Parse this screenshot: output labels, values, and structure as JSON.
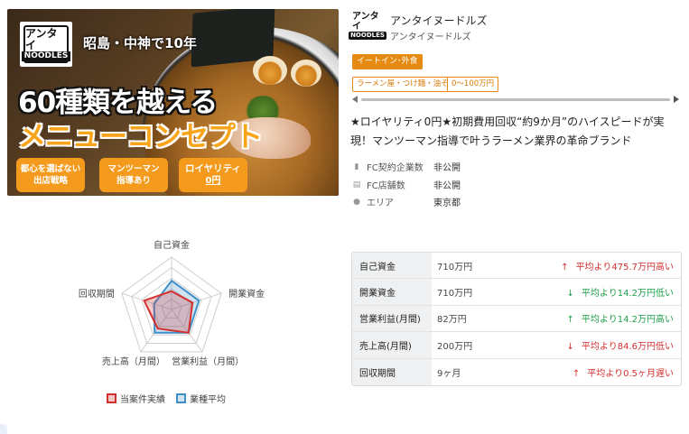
{
  "hero": {
    "logo_top": "アンタイ",
    "logo_bottom": "NOODLES",
    "tag": "昭島・中神で10年",
    "line1": "60種類を越える",
    "line2": "メニューコンセプト",
    "badges": [
      {
        "line1": "都心を選ばない",
        "line2": "出店戦略"
      },
      {
        "line1": "マンツーマン",
        "line2": "指導あり"
      },
      {
        "line1": "ロイヤリティ",
        "line2": "0円"
      }
    ]
  },
  "brand": {
    "logo_top": "アンタイ",
    "logo_bottom": "NOODLES",
    "name": "アンタイヌードルズ",
    "sub": "アンタイヌードルズ"
  },
  "tags": {
    "category": "イートイン･外食",
    "sub": [
      "ラーメン屋・つけ麺・油そば",
      "0～100万円"
    ]
  },
  "headline": "★ロイヤリティ0円★初期費用回収“約9か月”のハイスピードが実現！マンツーマン指導で叶うラーメン業界の革命ブランド",
  "meta": [
    {
      "icon": "building-icon",
      "label": "FC契約企業数",
      "value": "非公開"
    },
    {
      "icon": "store-icon",
      "label": "FC店舗数",
      "value": "非公開"
    },
    {
      "icon": "location-pin-icon",
      "label": "エリア",
      "value": "東京都"
    }
  ],
  "chart_data": {
    "type": "radar",
    "axes": [
      "自己資金",
      "開業資金",
      "営業利益（月間）",
      "売上高（月間）",
      "回収期間"
    ],
    "series": [
      {
        "name": "当案件実績",
        "values": [
          0.35,
          0.42,
          0.55,
          0.45,
          0.55
        ],
        "color": "#d32f2f"
      },
      {
        "name": "業種平均",
        "values": [
          0.55,
          0.55,
          0.55,
          0.55,
          0.35
        ],
        "color": "#3f8fc9"
      }
    ],
    "legend_position": "bottom"
  },
  "table": [
    {
      "label": "自己資金",
      "value": "710万円",
      "arrow": "↑",
      "compare": "平均より475.7万円高い",
      "tone": "up-red"
    },
    {
      "label": "開業資金",
      "value": "710万円",
      "arrow": "↓",
      "compare": "平均より14.2万円低い",
      "tone": "down-green"
    },
    {
      "label": "営業利益(月間)",
      "value": "82万円",
      "arrow": "↑",
      "compare": "平均より14.2万円高い",
      "tone": "up-green"
    },
    {
      "label": "売上高(月間)",
      "value": "200万円",
      "arrow": "↓",
      "compare": "平均より84.6万円低い",
      "tone": "down-red"
    },
    {
      "label": "回収期間",
      "value": "9ヶ月",
      "arrow": "↑",
      "compare": "平均より0.5ヶ月遅い",
      "tone": "up-red"
    }
  ]
}
